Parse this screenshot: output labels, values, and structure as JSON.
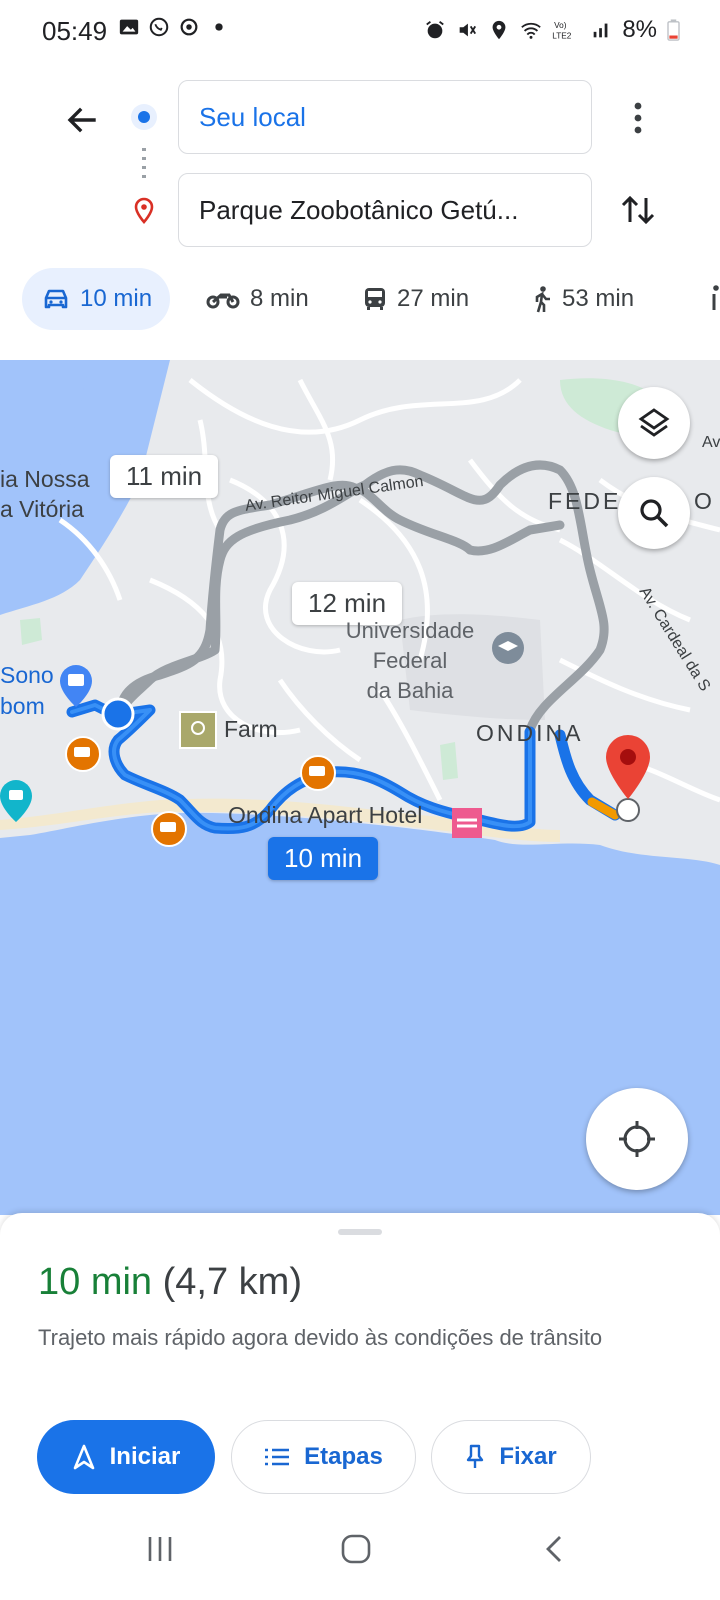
{
  "status_bar": {
    "time": "05:49",
    "battery": "8%",
    "icons": [
      "gallery-icon",
      "whatsapp-icon",
      "sync-icon",
      "dot-icon",
      "alarm-icon",
      "mute-icon",
      "location-icon",
      "wifi-icon",
      "volte-icon",
      "signal-icon",
      "battery-icon"
    ]
  },
  "search": {
    "origin": "Seu local",
    "destination": "Parque Zoobotânico Getú..."
  },
  "modes": [
    {
      "name": "car",
      "label": "10 min",
      "selected": true
    },
    {
      "name": "motorcycle",
      "label": "8 min",
      "selected": false
    },
    {
      "name": "transit",
      "label": "27 min",
      "selected": false
    },
    {
      "name": "walk",
      "label": "53 min",
      "selected": false
    }
  ],
  "map": {
    "route_times": {
      "main": "10 min",
      "alt1": "11 min",
      "alt2": "12 min"
    },
    "labels": {
      "street1": "Av. Reitor Miguel Calmon",
      "district_fed": "FEDE",
      "district_fed_end": "O",
      "ondina": "ONDINA",
      "street2": "Av. Cardeal da S",
      "street2_top": "Av",
      "nossa": "ia Nossa",
      "vitoria": "a Vitória",
      "sono": "Sono",
      "bom": "bom",
      "farm": "Farm",
      "hotel": "Ondina Apart Hotel",
      "university": "Universidade\nFederal\nda Bahia"
    },
    "colors": {
      "water": "#a1c3fa",
      "land": "#e8eaed",
      "route": "#1a73e8",
      "alt_route": "#9aa0a6",
      "traffic": "#f29900",
      "pin": "#ea4335"
    }
  },
  "sheet": {
    "duration": "10 min",
    "distance": "(4,7 km)",
    "description": "Trajeto mais rápido agora devido às condições de trânsito",
    "buttons": {
      "start": "Iniciar",
      "steps": "Etapas",
      "pin": "Fixar"
    }
  }
}
